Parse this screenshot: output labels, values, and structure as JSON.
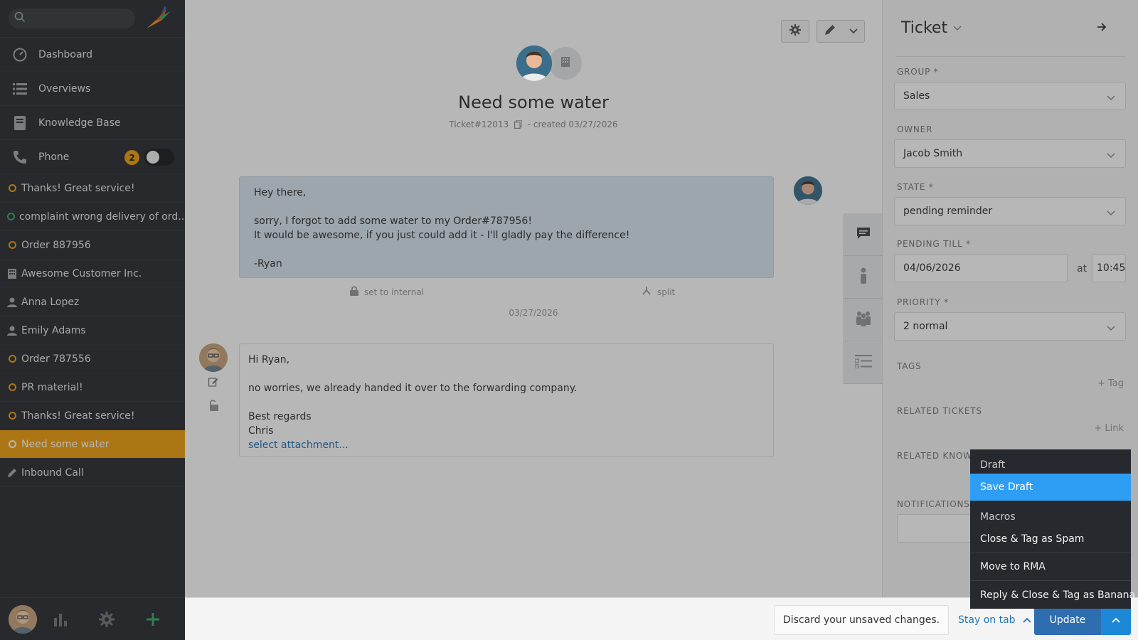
{
  "sidebar": {
    "search_placeholder": "",
    "nav": [
      {
        "label": "Dashboard",
        "icon": "dashboard-icon"
      },
      {
        "label": "Overviews",
        "icon": "list-icon"
      },
      {
        "label": "Knowledge Base",
        "icon": "book-icon"
      },
      {
        "label": "Phone",
        "icon": "phone-icon",
        "badge": "2"
      }
    ],
    "tasks": [
      {
        "label": "Thanks! Great service!",
        "icon": "ring-orange"
      },
      {
        "label": "complaint wrong delivery of ord...",
        "icon": "ring-green"
      },
      {
        "label": "Order 887956",
        "icon": "ring-orange"
      },
      {
        "label": "Awesome Customer Inc.",
        "icon": "building-icon"
      },
      {
        "label": "Anna Lopez",
        "icon": "person-icon"
      },
      {
        "label": "Emily Adams",
        "icon": "person-icon"
      },
      {
        "label": "Order 787556",
        "icon": "ring-orange"
      },
      {
        "label": "PR material!",
        "icon": "ring-orange"
      },
      {
        "label": "Thanks! Great service!",
        "icon": "ring-orange"
      },
      {
        "label": "Need some water",
        "icon": "ring-orange",
        "active": true
      },
      {
        "label": "Inbound Call",
        "icon": "pencil-icon"
      }
    ]
  },
  "ticket": {
    "title": "Need some water",
    "number": "Ticket#12013",
    "created": "- created 03/27/2026"
  },
  "articles": {
    "customer": {
      "lines": [
        "Hey there,",
        "",
        "sorry, I forgot to add some water to my Order#787956!",
        "It would be awesome, if you just could add it - I'll gladly pay the difference!",
        "",
        "-Ryan"
      ]
    },
    "actions": {
      "internal": "set to internal",
      "split": "split"
    },
    "date": "03/27/2026",
    "reply": {
      "lines": [
        "Hi Ryan,",
        "",
        "no worries, we already handed it over to the forwarding company.",
        "",
        "Best regards",
        "Chris"
      ],
      "attachment": "select attachment..."
    }
  },
  "panel": {
    "title": "Ticket",
    "group": {
      "label": "GROUP *",
      "value": "Sales"
    },
    "owner": {
      "label": "OWNER",
      "value": "Jacob Smith"
    },
    "state": {
      "label": "STATE *",
      "value": "pending reminder"
    },
    "pending": {
      "label": "PENDING TILL *",
      "date": "04/06/2026",
      "at": "at",
      "time": "10:45"
    },
    "priority": {
      "label": "PRIORITY *",
      "value": "2 normal"
    },
    "tags": {
      "label": "TAGS",
      "add": "+ Tag"
    },
    "related": {
      "label": "RELATED TICKETS",
      "add": "+ Link"
    },
    "knowledge": {
      "label": "RELATED KNOWL"
    },
    "notifications": {
      "label": "NOTIFICATIONS"
    }
  },
  "bottom": {
    "discard": "Discard your unsaved changes.",
    "stay": "Stay on tab",
    "update": "Update"
  },
  "dropdown": {
    "draft_header": "Draft",
    "save_draft": "Save Draft",
    "macros_header": "Macros",
    "macros": [
      "Close & Tag as Spam",
      "Move to RMA",
      "Reply & Close & Tag as Banana"
    ]
  },
  "colors": {
    "accent": "#f0a010",
    "primary": "#2e6eb0",
    "highlight": "#2e9ef5",
    "sidebar": "#2b2e33"
  }
}
